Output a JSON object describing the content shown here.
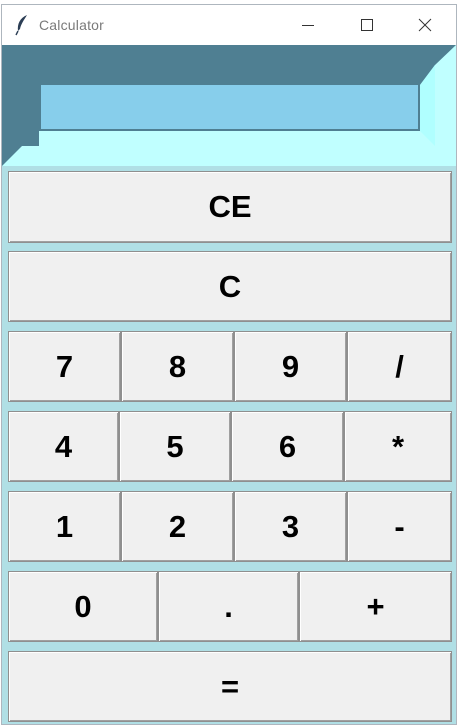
{
  "window": {
    "title": "Calculator",
    "icon": "feather-icon",
    "controls": [
      "minimize-icon",
      "maximize-icon",
      "close-icon"
    ]
  },
  "display": {
    "value": "",
    "background_color": "#87ceeb",
    "frame_light_color": "#c0ffff",
    "frame_dark_color": "#4f7f92"
  },
  "buttons": {
    "ce": "CE",
    "c": "C",
    "seven": "7",
    "eight": "8",
    "nine": "9",
    "divide": "/",
    "four": "4",
    "five": "5",
    "six": "6",
    "multiply": "*",
    "one": "1",
    "two": "2",
    "three": "3",
    "subtract": "-",
    "zero": "0",
    "decimal": ".",
    "add": "+",
    "equals": "="
  },
  "colors": {
    "window_background": "#b0dfe5",
    "button_face": "#f0f0f0"
  }
}
